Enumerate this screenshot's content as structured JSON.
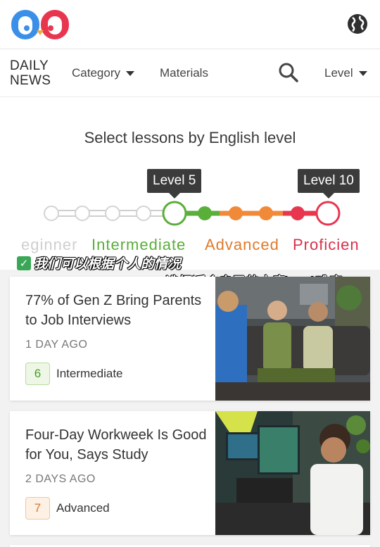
{
  "header": {
    "logo_icon": "owl-eyes-logo",
    "globe_icon": "globe-icon"
  },
  "nav": {
    "brand_line1": "DAILY",
    "brand_line2": "NEWS",
    "category": "Category",
    "materials": "Materials",
    "search_icon": "search-icon",
    "level": "Level"
  },
  "hero": {
    "title": "Select lessons by English level",
    "tooltip_left": "Level 5",
    "tooltip_right": "Level 10",
    "levels": [
      "eginner",
      "Intermediate",
      "Advanced",
      "Proficien"
    ],
    "level_colors": {
      "beginner": "#cfcfcf",
      "intermediate": "#5aae3a",
      "advanced": "#f08a38",
      "proficient": "#e8364f"
    },
    "selected_range": [
      5,
      10
    ]
  },
  "captions": {
    "line1": "我们可以根据个人的情况",
    "line2": "选择适合自己的文章level难度"
  },
  "articles": [
    {
      "title": "77% of Gen Z Bring Parents to Job Interviews",
      "date": "1 DAY AGO",
      "level_number": "6",
      "level_name": "Intermediate"
    },
    {
      "title": "Four-Day Workweek Is Good for You, Says Study",
      "date": "2 DAYS AGO",
      "level_number": "7",
      "level_name": "Advanced"
    }
  ]
}
